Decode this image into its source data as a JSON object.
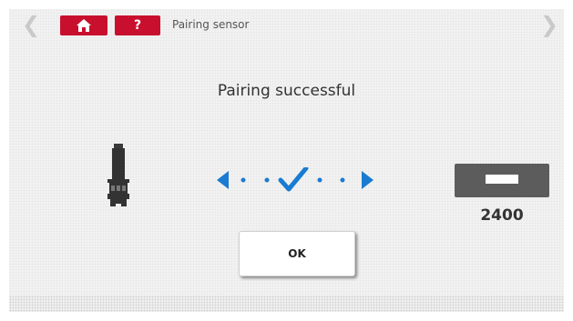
{
  "header": {
    "prev_icon": "chevron-left-icon",
    "next_icon": "chevron-right-icon",
    "home_icon": "home-icon",
    "help_label": "?",
    "breadcrumb": "Pairing sensor"
  },
  "main": {
    "message": "Pairing successful",
    "sensor_icon": "sensor-icon",
    "signal_icon": "pairing-success-icon",
    "device_icon": "device-icon",
    "device_value": "2400",
    "ok_label": "OK"
  },
  "colors": {
    "accent_red": "#c8102e",
    "accent_blue": "#1a7bd1",
    "device_gray": "#5c5c5c"
  }
}
